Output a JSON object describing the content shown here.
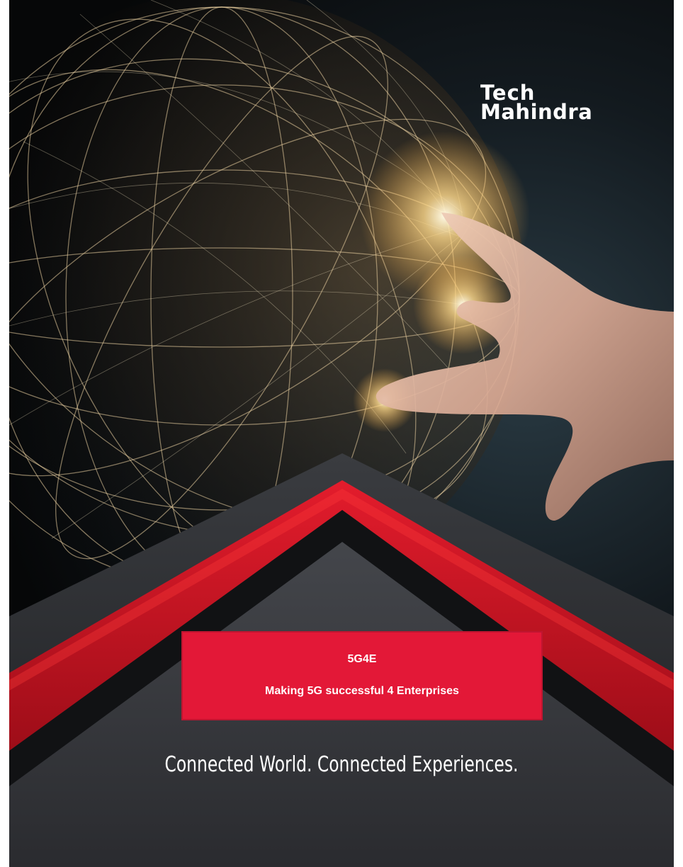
{
  "brand": {
    "logo_line1": "Tech",
    "logo_line2": "Mahindra"
  },
  "cover": {
    "code": "5G4E",
    "subtitle": "Making 5G successful 4 Enterprises",
    "tagline": "Connected World. Connected Experiences."
  },
  "colors": {
    "brand_red": "#e31837",
    "dark_grey": "#2e3034",
    "background": "#060708"
  },
  "icons": [
    "globe-network-graphic",
    "hand-graphic",
    "chevron-graphic"
  ]
}
